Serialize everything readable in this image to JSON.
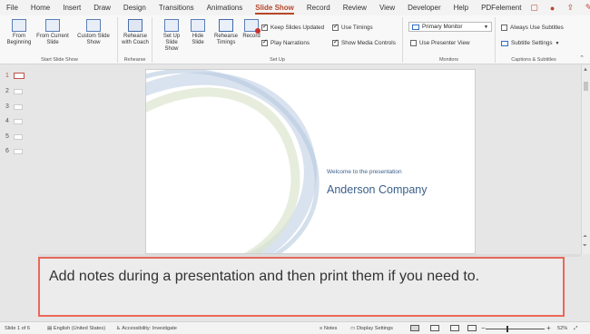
{
  "menu": {
    "tabs": [
      "File",
      "Home",
      "Insert",
      "Draw",
      "Design",
      "Transitions",
      "Animations",
      "Slide Show",
      "Record",
      "Review",
      "View",
      "Developer",
      "Help",
      "PDFelement"
    ],
    "active_tab": "Slide Show"
  },
  "ribbon": {
    "start": {
      "from_beginning": "From Beginning",
      "from_current": "From Current Slide",
      "custom": "Custom Slide Show",
      "label": "Start Slide Show"
    },
    "rehearse_group": {
      "rehearse_coach": "Rehearse with Coach",
      "label": "Rehearse"
    },
    "setup": {
      "setup_show": "Set Up Slide Show",
      "hide_slide": "Hide Slide",
      "rehearse_timings": "Rehearse Timings",
      "record": "Record",
      "keep_updated": "Keep Slides Updated",
      "use_timings": "Use Timings",
      "play_narrations": "Play Narrations",
      "show_media": "Show Media Controls",
      "label": "Set Up"
    },
    "monitors": {
      "monitor_value": "Primary Monitor",
      "presenter_view": "Use Presenter View",
      "label": "Monitors"
    },
    "captions": {
      "always_subtitles": "Always Use Subtitles",
      "subtitle_settings": "Subtitle Settings",
      "label": "Captions & Subtitles"
    }
  },
  "thumbnails": [
    "1",
    "2",
    "3",
    "4",
    "5",
    "6"
  ],
  "slide": {
    "subtitle": "Welcome to the presentation",
    "title": "Anderson Company"
  },
  "notes": {
    "text": "Add notes during a presentation and then print them if you need to."
  },
  "status": {
    "slide_info": "Slide 1 of 6",
    "language": "English (United States)",
    "accessibility": "Accessibility: Investigate",
    "notes": "Notes",
    "display_settings": "Display Settings",
    "zoom": "52%"
  },
  "colors": {
    "accent": "#b7472a",
    "notes_border": "#e8685a",
    "slide_text": "#3b5f8a"
  }
}
